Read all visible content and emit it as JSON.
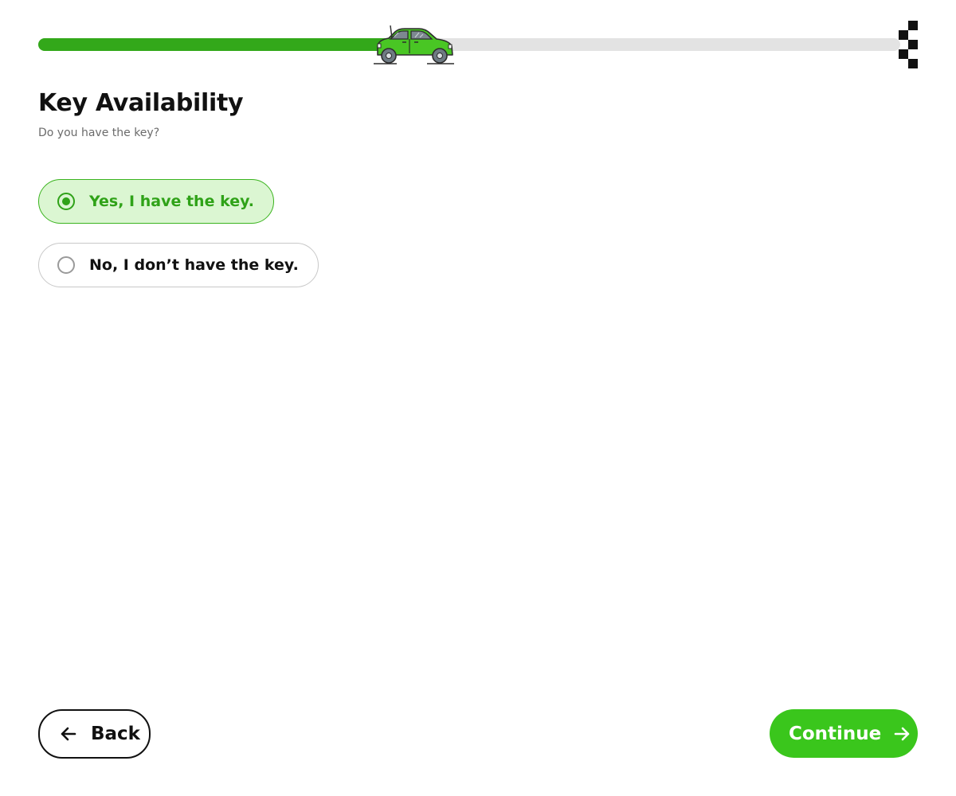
{
  "progress": {
    "value": 0.43,
    "fill_color": "#33a81a",
    "track_color": "#e3e3e3",
    "marker_icon": "car-icon",
    "end_icon": "checkered-flag-icon"
  },
  "page": {
    "title": "Key Availability",
    "subtitle": "Do you have the key?"
  },
  "question": {
    "options": [
      {
        "label": "Yes, I have the key.",
        "selected": true
      },
      {
        "label": "No, I don’t have the key.",
        "selected": false
      }
    ]
  },
  "footer": {
    "back_label": "Back",
    "back_icon": "arrow-left-icon",
    "continue_label": "Continue",
    "continue_icon": "arrow-right-icon"
  },
  "colors": {
    "accent": "#3ac61c",
    "selected_text": "#2fa218",
    "selected_background": "#dbf6d2"
  }
}
